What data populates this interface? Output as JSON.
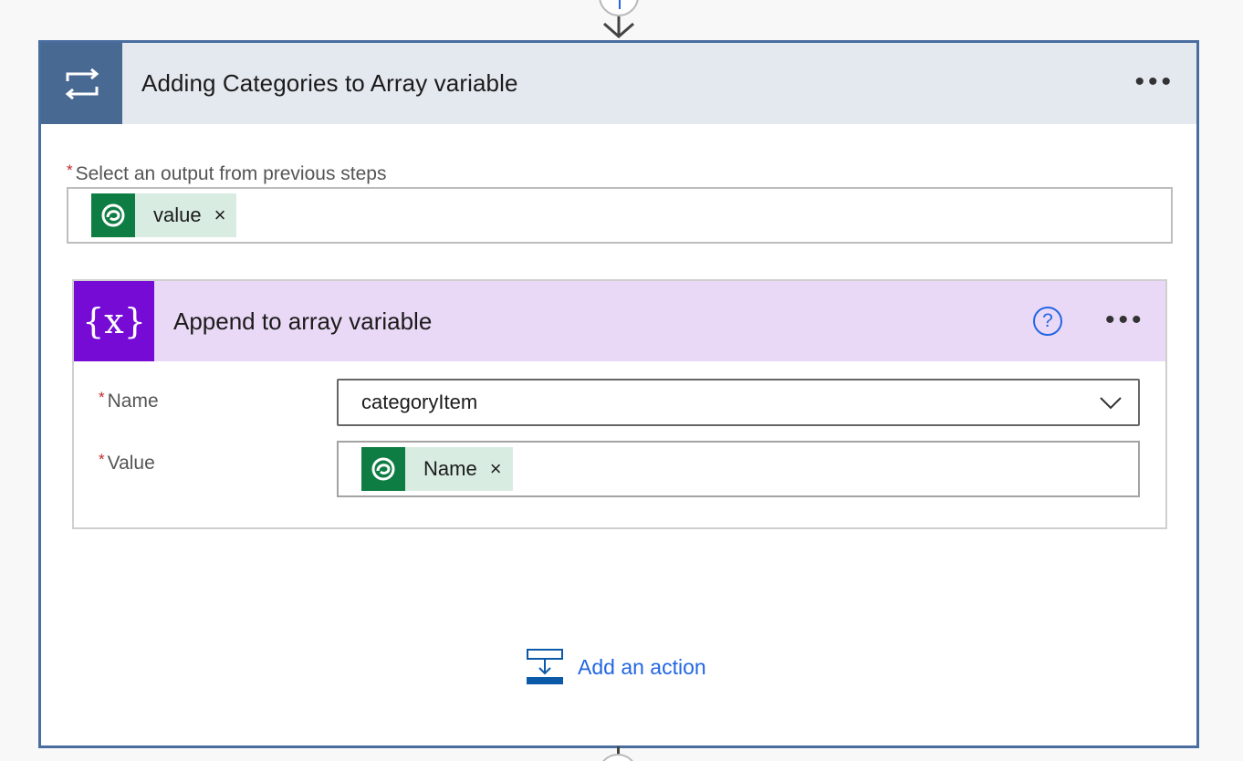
{
  "loop": {
    "title": "Adding Categories to Array variable",
    "icon": "loop-icon",
    "more_label": "•••",
    "output_field": {
      "label": "Select an output from previous steps",
      "required_mark": "*",
      "token": {
        "label": "value",
        "remove": "×",
        "icon": "dataverse-icon"
      }
    }
  },
  "action": {
    "title": "Append to array variable",
    "icon_text": "{x}",
    "help_label": "?",
    "more_label": "•••",
    "params": [
      {
        "label": "Name",
        "required_mark": "*",
        "value": "categoryItem"
      },
      {
        "label": "Value",
        "required_mark": "*",
        "token": {
          "label": "Name",
          "remove": "×",
          "icon": "dataverse-icon"
        }
      }
    ]
  },
  "add_action": {
    "label": "Add an action"
  },
  "colors": {
    "loop_accent": "#486991",
    "variable_accent": "#770bd6",
    "dataverse_green": "#0e7d43",
    "link_blue": "#2266e3"
  }
}
